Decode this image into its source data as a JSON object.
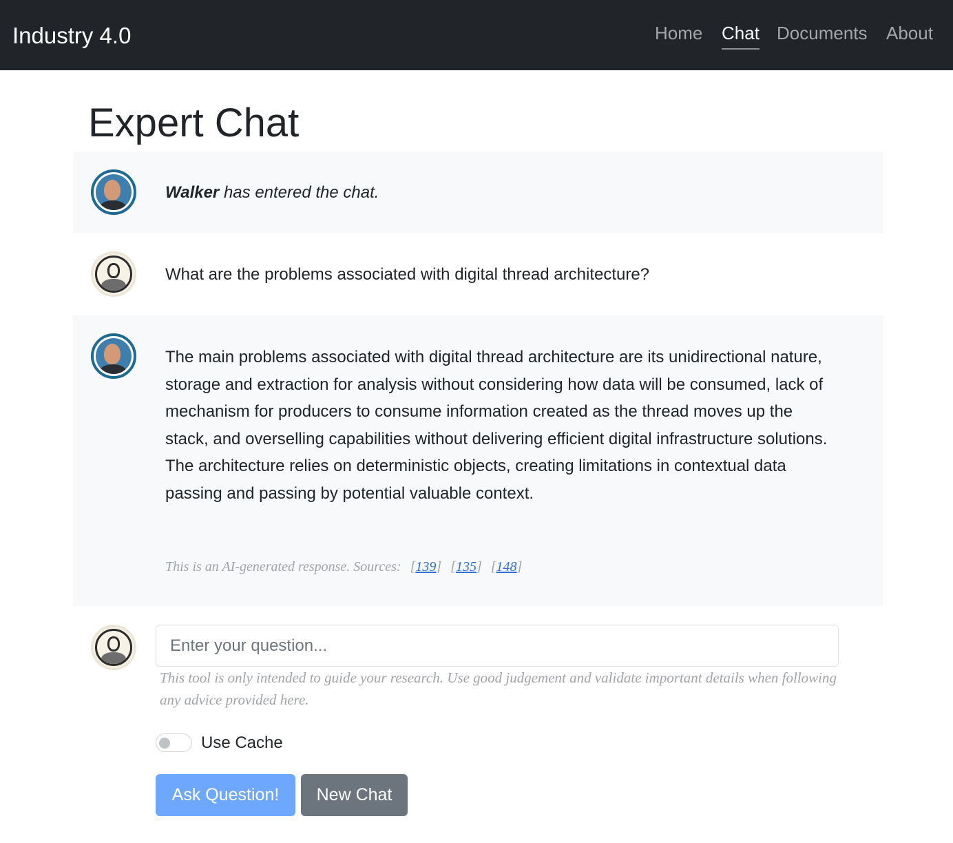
{
  "navbar": {
    "brand": "Industry 4.0",
    "links": [
      "Home",
      "Chat",
      "Documents",
      "About"
    ],
    "active": "Chat"
  },
  "page_title": "Expert Chat",
  "messages": [
    {
      "role": "expert",
      "name": "Walker",
      "text": "has entered the chat."
    },
    {
      "role": "user",
      "text": "What are the problems associated with digital thread architecture?"
    },
    {
      "role": "expert",
      "text": "The main problems associated with digital thread architecture are its unidirectional nature, storage and extraction for analysis without considering how data will be consumed, lack of mechanism for producers to consume information created as the thread moves up the stack, and overselling capabilities without delivering efficient digital infrastructure solutions. The architecture relies on deterministic objects, creating limitations in contextual data passing and passing by potential valuable context.",
      "sources_label": "This is an AI-generated response. Sources:",
      "sources": [
        "139",
        "135",
        "148"
      ]
    }
  ],
  "input": {
    "placeholder": "Enter your question...",
    "value": "",
    "disclaimer": "This tool is only intended to guide your research. Use good judgement and validate important details when following any advice provided here."
  },
  "toggle": {
    "label": "Use Cache",
    "checked": false
  },
  "buttons": {
    "ask": "Ask Question!",
    "new_chat": "New Chat"
  },
  "colors": {
    "navbar_bg": "#212529",
    "primary": "#6ea8fe",
    "secondary": "#6c757d",
    "expert_ring": "#1f6a91",
    "link": "#2f6fd6"
  },
  "icons": {
    "expert_avatar": "expert-avatar-icon",
    "user_avatar": "user-avatar-icon"
  }
}
